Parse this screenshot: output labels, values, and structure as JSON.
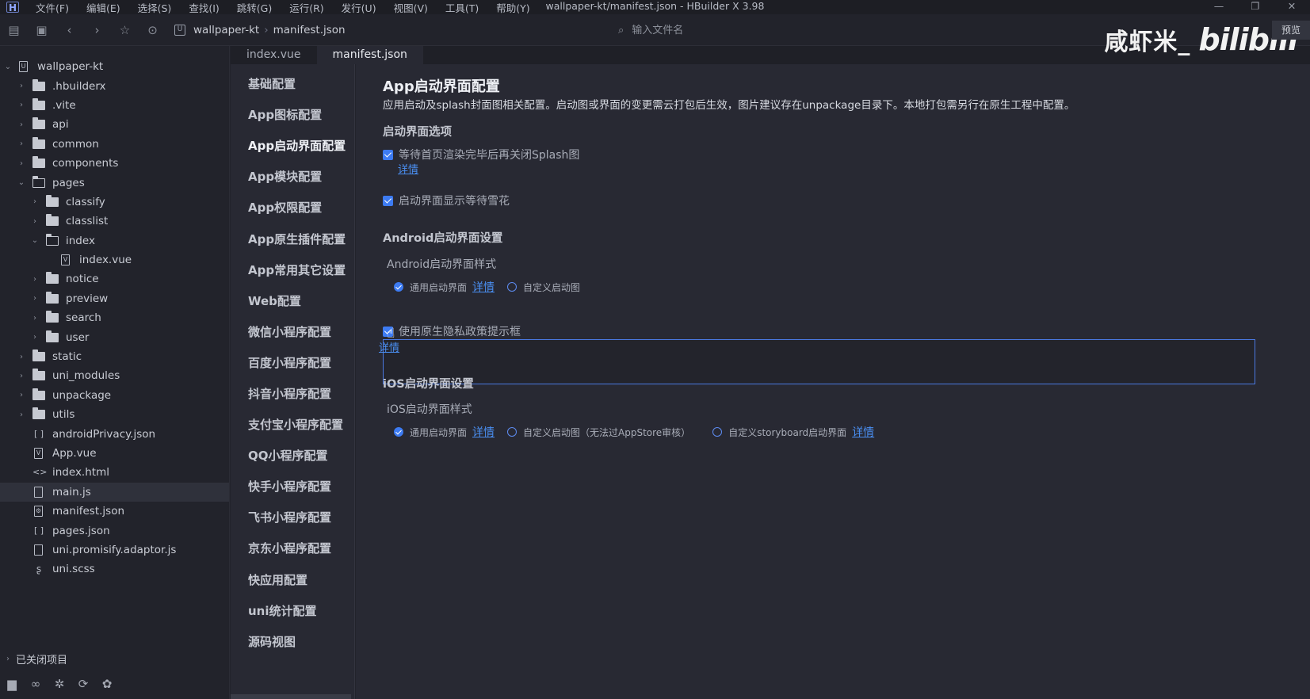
{
  "app": {
    "title": "wallpaper-kt/manifest.json - HBuilder X 3.98",
    "logo_letter": "H",
    "menu": [
      "文件(F)",
      "编辑(E)",
      "选择(S)",
      "查找(I)",
      "跳转(G)",
      "运行(R)",
      "发行(U)",
      "视图(V)",
      "工具(T)",
      "帮助(Y)"
    ]
  },
  "toolbar": {
    "breadcrumb": [
      "wallpaper-kt",
      "manifest.json"
    ],
    "search_placeholder": "输入文件名",
    "preview_label": "预览"
  },
  "watermark": {
    "author": "咸虾米_",
    "site": "bilibili"
  },
  "explorer": {
    "root": "wallpaper-kt",
    "rows": [
      {
        "label": ".hbuilderx",
        "depth": 1,
        "kind": "folder"
      },
      {
        "label": ".vite",
        "depth": 1,
        "kind": "folder"
      },
      {
        "label": "api",
        "depth": 1,
        "kind": "folder"
      },
      {
        "label": "common",
        "depth": 1,
        "kind": "folder"
      },
      {
        "label": "components",
        "depth": 1,
        "kind": "folder"
      },
      {
        "label": "pages",
        "depth": 1,
        "kind": "folder-open"
      },
      {
        "label": "classify",
        "depth": 2,
        "kind": "folder"
      },
      {
        "label": "classlist",
        "depth": 2,
        "kind": "folder"
      },
      {
        "label": "index",
        "depth": 2,
        "kind": "folder-open"
      },
      {
        "label": "index.vue",
        "depth": 3,
        "kind": "vue"
      },
      {
        "label": "notice",
        "depth": 2,
        "kind": "folder"
      },
      {
        "label": "preview",
        "depth": 2,
        "kind": "folder"
      },
      {
        "label": "search",
        "depth": 2,
        "kind": "folder"
      },
      {
        "label": "user",
        "depth": 2,
        "kind": "folder"
      },
      {
        "label": "static",
        "depth": 1,
        "kind": "folder"
      },
      {
        "label": "uni_modules",
        "depth": 1,
        "kind": "folder"
      },
      {
        "label": "unpackage",
        "depth": 1,
        "kind": "folder"
      },
      {
        "label": "utils",
        "depth": 1,
        "kind": "folder"
      },
      {
        "label": "androidPrivacy.json",
        "depth": 1,
        "kind": "json"
      },
      {
        "label": "App.vue",
        "depth": 1,
        "kind": "vue"
      },
      {
        "label": "index.html",
        "depth": 1,
        "kind": "html"
      },
      {
        "label": "main.js",
        "depth": 1,
        "kind": "js",
        "selected": true
      },
      {
        "label": "manifest.json",
        "depth": 1,
        "kind": "manifest"
      },
      {
        "label": "pages.json",
        "depth": 1,
        "kind": "json"
      },
      {
        "label": "uni.promisify.adaptor.js",
        "depth": 1,
        "kind": "js"
      },
      {
        "label": "uni.scss",
        "depth": 1,
        "kind": "scss"
      }
    ],
    "closed_projects": "已关闭项目"
  },
  "tabs": [
    {
      "label": "index.vue",
      "active": false
    },
    {
      "label": "manifest.json",
      "active": true
    }
  ],
  "config_nav": [
    {
      "label": "基础配置"
    },
    {
      "label": "App图标配置"
    },
    {
      "label": "App启动界面配置",
      "active": true
    },
    {
      "label": "App模块配置"
    },
    {
      "label": "App权限配置"
    },
    {
      "label": "App原生插件配置"
    },
    {
      "label": "App常用其它设置"
    },
    {
      "label": "Web配置"
    },
    {
      "label": "微信小程序配置"
    },
    {
      "label": "百度小程序配置"
    },
    {
      "label": "抖音小程序配置"
    },
    {
      "label": "支付宝小程序配置"
    },
    {
      "label": "QQ小程序配置"
    },
    {
      "label": "快手小程序配置"
    },
    {
      "label": "飞书小程序配置"
    },
    {
      "label": "京东小程序配置"
    },
    {
      "label": "快应用配置"
    },
    {
      "label": "uni统计配置"
    },
    {
      "label": "源码视图"
    }
  ],
  "content": {
    "title": "App启动界面配置",
    "description": "应用启动及splash封面图相关配置。启动图或界面的变更需云打包后生效，图片建议存在unpackage目录下。本地打包需另行在原生工程中配置。",
    "splash_options_heading": "启动界面选项",
    "wait_render_label": "等待首页渲染完毕后再关闭Splash图",
    "details_label": "详情",
    "show_waiting_label": "启动界面显示等待雪花",
    "android_heading": "Android启动界面设置",
    "android_style_label": "Android启动界面样式",
    "android_opt_general": "通用启动界面",
    "android_opt_custom": "自定义启动图",
    "privacy_label": "使用原生隐私政策提示框",
    "ios_heading": "iOS启动界面设置",
    "ios_style_label": "iOS启动界面样式",
    "ios_opt_general": "通用启动界面",
    "ios_opt_custom": "自定义启动图（无法过AppStore审核）",
    "ios_opt_storyboard": "自定义storyboard启动界面"
  }
}
